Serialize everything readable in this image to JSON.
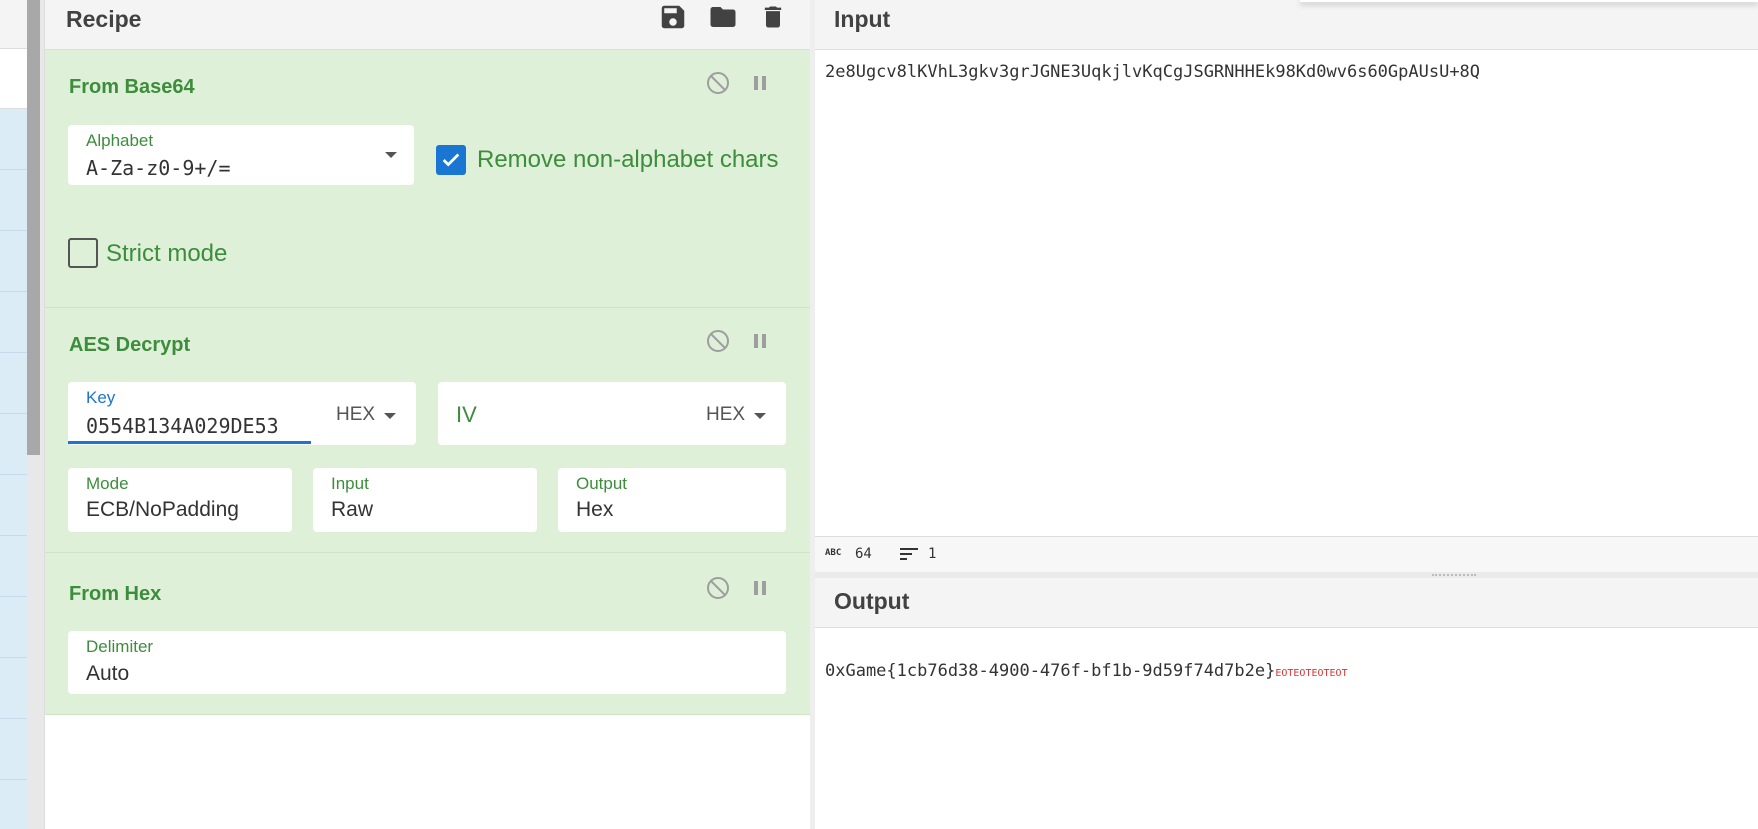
{
  "recipe": {
    "title": "Recipe",
    "icons": [
      "save-icon",
      "folder-icon",
      "trash-icon"
    ]
  },
  "operations": [
    {
      "title": "From Base64",
      "alphabet_label": "Alphabet",
      "alphabet_value": "A-Za-z0-9+/=",
      "remove_label": "Remove non-alphabet chars",
      "remove_checked": true,
      "strict_label": "Strict mode",
      "strict_checked": false
    },
    {
      "title": "AES Decrypt",
      "key_label": "Key",
      "key_value": "0554B134A029DE53",
      "key_format": "HEX",
      "iv_placeholder": "IV",
      "iv_format": "HEX",
      "mode_label": "Mode",
      "mode_value": "ECB/NoPadding",
      "input_label": "Input",
      "input_value": "Raw",
      "output_label": "Output",
      "output_value": "Hex"
    },
    {
      "title": "From Hex",
      "delimiter_label": "Delimiter",
      "delimiter_value": "Auto"
    }
  ],
  "input": {
    "title": "Input",
    "text": "2e8Ugcv8lKVhL3gkv3grJGNE3UqkjlvKqCgJSGRNHHEk98Kd0wv6s60GpAUsU+8Q",
    "status": {
      "length_icon": "abc-icon",
      "length": "64",
      "lines_icon": "lines-icon",
      "lines": "1"
    }
  },
  "output": {
    "title": "Output",
    "text": "0xGame{1cb76d38-4900-476f-bf1b-9d59f74d7b2e}",
    "control_chars": "EOTEOTEOTEOT"
  },
  "colors": {
    "op_background": "#dff0d8",
    "op_title": "#3c8d3c",
    "checkbox_blue": "#1976d2",
    "control_red": "#dd3333"
  }
}
